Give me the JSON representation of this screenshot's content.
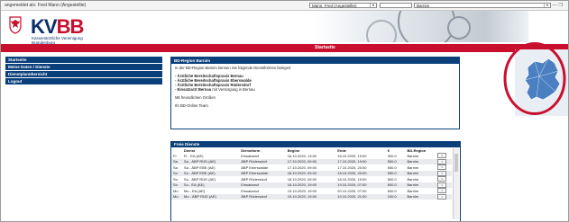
{
  "topbar": {
    "login_text": "angemeldet als: Fred Mann (Angestellte)",
    "user_select": "Mann, Fred (Angestellte)",
    "region_select": "Barnim"
  },
  "header": {
    "logo_kv": "KV",
    "logo_bb": "BB",
    "logo_sub1": "Kassenärztliche Vereinigung",
    "logo_sub2": "Brandenburg"
  },
  "page_title": "Startseite",
  "sidebar": {
    "items": [
      {
        "label": "Startseite"
      },
      {
        "label": "Meine Daten / Dienste"
      },
      {
        "label": "Dienstplanübersicht"
      },
      {
        "label": "Logout"
      }
    ]
  },
  "info_box": {
    "title": "BD-Region Barnim",
    "intro": "In der BD-Region Barnim können Sie folgende Dienstformen belegen:",
    "items": [
      {
        "bold": "- Ärztliche Bereitschaftspraxis Bernau",
        "rest": ""
      },
      {
        "bold": "- Ärztliche Bereitschaftspraxis Eberswalde",
        "rest": ""
      },
      {
        "bold": "- Ärztliche Bereitschaftspraxis Rüdersdorf",
        "rest": ""
      },
      {
        "bold": "- Einsatzarzt Bernau",
        "rest": " mit Versorgung in Bernau"
      }
    ],
    "greeting": "Mit freundlichen Grüßen",
    "signature": "Ihr BD-Online Team"
  },
  "services": {
    "title": "Freie Dienste",
    "columns": [
      "",
      "Dienst",
      "Dienstform",
      "Beginn",
      "Ende",
      "€",
      "BD-Region",
      ""
    ],
    "rows": [
      {
        "day": "Fr",
        "dienst": "Fr - EA (AE)",
        "form": "Einsatzarzt",
        "begin": "16.10.2020, 13:00",
        "end": "16.10.2020, 19:00",
        "eur": "300.0",
        "region": "Barnim"
      },
      {
        "day": "Sa",
        "dienst": "Sa - ÄBP RÜD (AE)",
        "form": "ÄBP Rüdersdorf",
        "begin": "17.10.2020, 09:00",
        "end": "17.10.2020, 19:00",
        "eur": "500.0",
        "region": "Barnim"
      },
      {
        "day": "Sa",
        "dienst": "Sa - ÄBP EBE (AE)",
        "form": "ÄBP Eberswalde",
        "begin": "17.10.2020, 09:00",
        "end": "17.10.2020, 20:00",
        "eur": "550.0",
        "region": "Barnim"
      },
      {
        "day": "So",
        "dienst": "So - ÄBP EBE (AE)",
        "form": "ÄBP Eberswalde",
        "begin": "18.10.2020, 09:00",
        "end": "18.10.2020, 20:00",
        "eur": "550.0",
        "region": "Barnim"
      },
      {
        "day": "So",
        "dienst": "So - ÄBP RÜD (AE)",
        "form": "ÄBP Rüdersdorf",
        "begin": "18.10.2020, 09:00",
        "end": "18.10.2020, 19:00",
        "eur": "500.0",
        "region": "Barnim"
      },
      {
        "day": "So",
        "dienst": "So - EA (AE)",
        "form": "Einsatzarzt",
        "begin": "18.10.2020, 19:00",
        "end": "19.10.2020, 07:00",
        "eur": "600.0",
        "region": "Barnim"
      },
      {
        "day": "Mo",
        "dienst": "Mo - EA (AE)",
        "form": "Einsatzarzt",
        "begin": "19.10.2020, 19:00",
        "end": "20.10.2020, 07:00",
        "eur": "600.0",
        "region": "Barnim"
      },
      {
        "day": "Mo",
        "dienst": "Mo - ÄBP RÜD (AE)",
        "form": "ÄBP Rüdersdorf",
        "begin": "19.10.2020, 19:00",
        "end": "19.10.2020, 21:00",
        "eur": "100.0",
        "region": "Barnim"
      }
    ],
    "detail_button": "⇒"
  },
  "colors": {
    "brand_blue": "#0a3f7a",
    "brand_red": "#c8102e",
    "map_blue": "#4a7fc1",
    "annotation_circle": "#c8102e"
  },
  "icons": {
    "logo": "brandenburg-eagle-icon",
    "map": "brandenburg-map-icon",
    "detail": "arrow-right-icon"
  }
}
